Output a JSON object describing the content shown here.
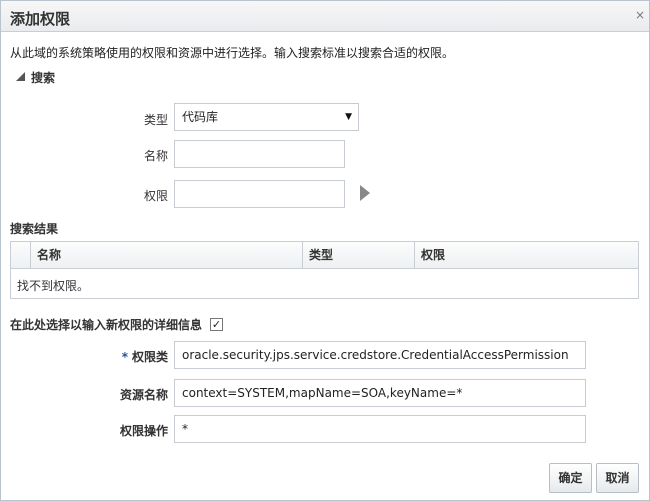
{
  "dialog": {
    "title": "添加权限",
    "close_glyph": "×"
  },
  "description": "从此域的系统策略使用的权限和资源中进行选择。输入搜索标准以搜索合适的权限。",
  "search": {
    "section_label": "搜索",
    "type_label": "类型",
    "type_value": "代码库",
    "name_label": "名称",
    "name_value": "",
    "permission_label": "权限",
    "permission_value": ""
  },
  "results": {
    "label": "搜索结果",
    "columns": [
      "名称",
      "类型",
      "权限"
    ],
    "empty_message": "找不到权限。"
  },
  "new_permission": {
    "checkbox_label": "在此处选择以输入新权限的详细信息",
    "checked": true,
    "required_marker": "*",
    "class_label": "权限类",
    "class_value": "oracle.security.jps.service.credstore.CredentialAccessPermission",
    "resource_label": "资源名称",
    "resource_value": "context=SYSTEM,mapName=SOA,keyName=*",
    "action_label": "权限操作",
    "action_value": "*"
  },
  "buttons": {
    "ok": "确定",
    "cancel": "取消"
  },
  "icons": {
    "close": "close-icon",
    "disclosure": "disclosure-triangle-icon",
    "dropdown": "chevron-down-icon",
    "go": "play-arrow-icon",
    "checkbox": "checkmark-icon"
  }
}
